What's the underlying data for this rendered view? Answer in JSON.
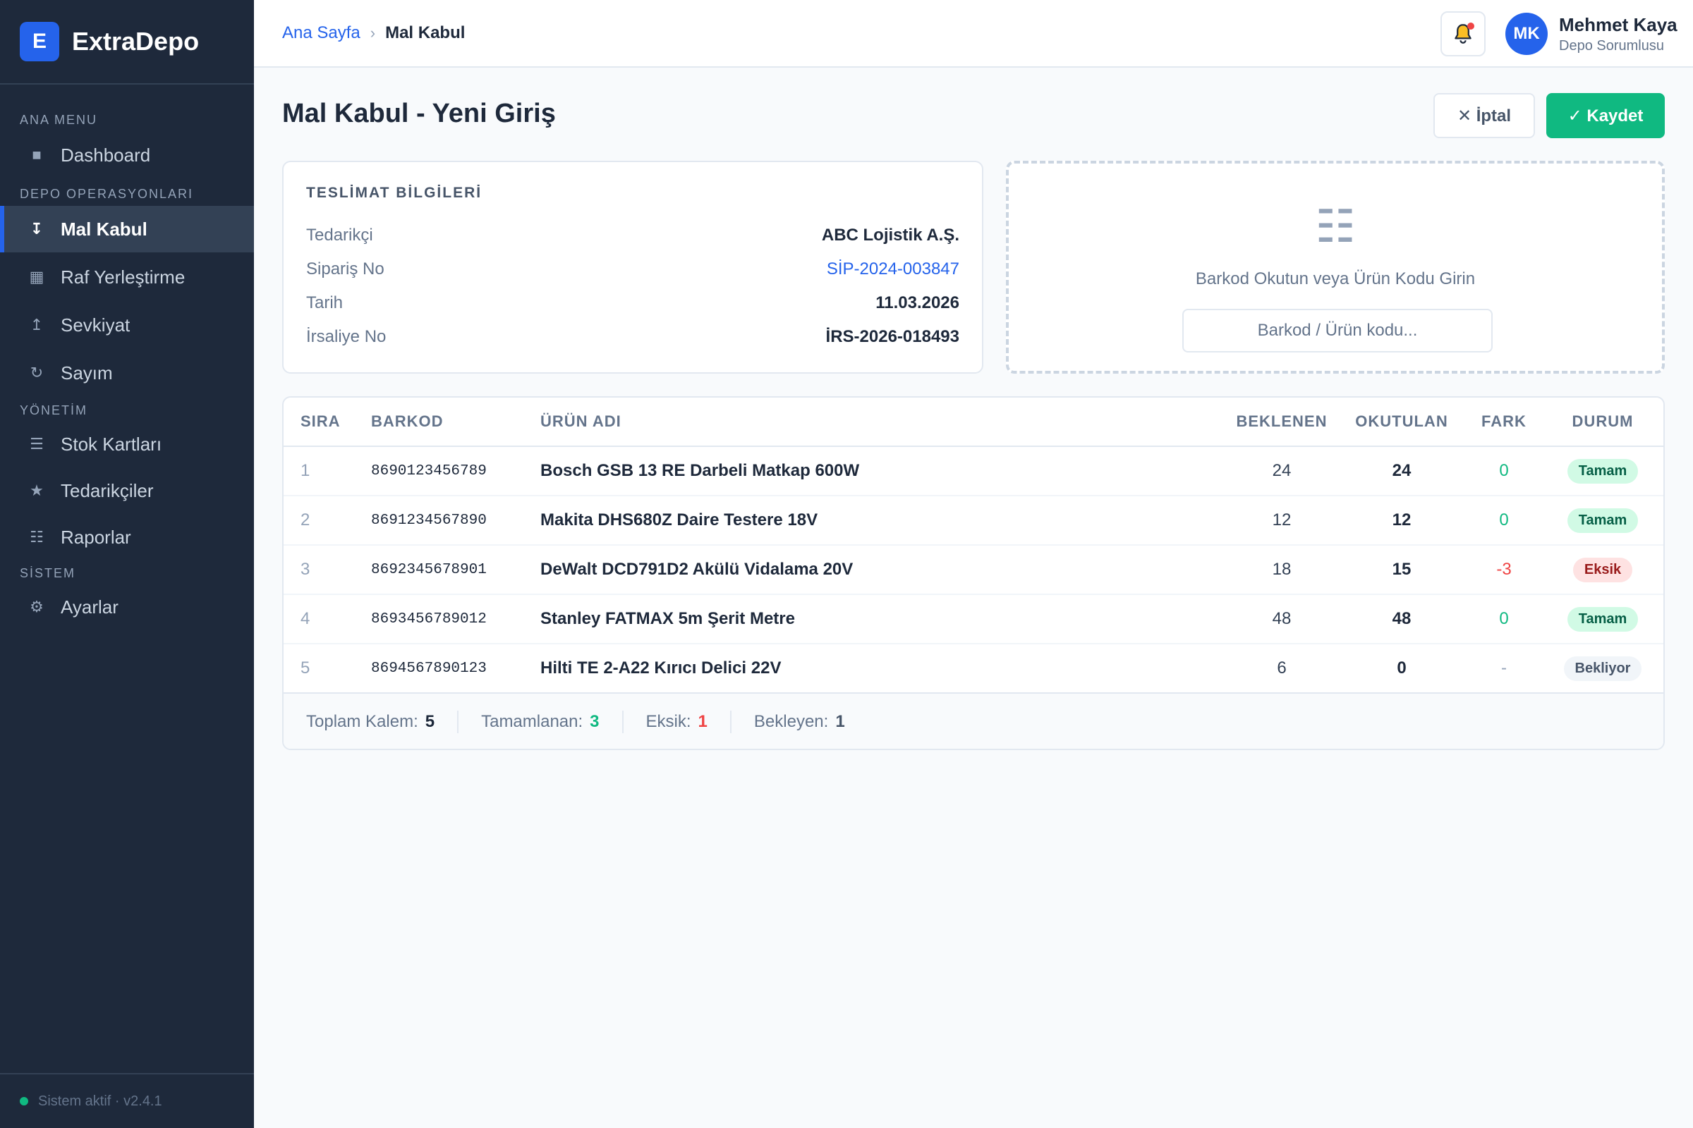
{
  "app": {
    "logo_letter": "E",
    "name": "ExtraDepo"
  },
  "sidebar": {
    "sections": [
      {
        "label": "ANA MENU"
      },
      {
        "label": "DEPO OPERASYONLARI"
      },
      {
        "label": "YÖNETİM"
      },
      {
        "label": "SİSTEM"
      }
    ],
    "items": [
      {
        "label": "Dashboard",
        "icon": "dashboard-icon",
        "glyph": "■"
      },
      {
        "label": "Mal Kabul",
        "icon": "receive-icon",
        "glyph": "↧",
        "active": true
      },
      {
        "label": "Raf Yerleştirme",
        "icon": "shelf-grid-icon",
        "glyph": "▦"
      },
      {
        "label": "Sevkiyat",
        "icon": "ship-icon",
        "glyph": "↥"
      },
      {
        "label": "Sayım",
        "icon": "count-icon",
        "glyph": "↻"
      },
      {
        "label": "Stok Kartları",
        "icon": "stock-list-icon",
        "glyph": "☰"
      },
      {
        "label": "Tedarikçiler",
        "icon": "star-icon",
        "glyph": "★"
      },
      {
        "label": "Raporlar",
        "icon": "report-icon",
        "glyph": "☷"
      },
      {
        "label": "Ayarlar",
        "icon": "gear-icon",
        "glyph": "⚙"
      }
    ],
    "footer": "Sistem aktif · v2.4.1"
  },
  "header": {
    "breadcrumb_home": "Ana Sayfa",
    "breadcrumb_sep": "›",
    "breadcrumb_current": "Mal Kabul",
    "user_initials": "MK",
    "user_name": "Mehmet Kaya",
    "user_role": "Depo Sorumlusu"
  },
  "page": {
    "title": "Mal Kabul - Yeni Giriş",
    "cancel_label": "✕ İptal",
    "save_label": "✓ Kaydet"
  },
  "delivery": {
    "title": "TESLİMAT BİLGİLERİ",
    "fields": [
      {
        "key": "Tedarikçi",
        "value": "ABC Lojistik A.Ş."
      },
      {
        "key": "Sipariş No",
        "value": "SİP-2024-003847"
      },
      {
        "key": "Tarih",
        "value": "11.03.2026"
      },
      {
        "key": "İrsaliye No",
        "value": "İRS-2026-018493"
      }
    ]
  },
  "scanner": {
    "icon_glyph": "☷",
    "prompt": "Barkod Okutun veya Ürün Kodu Girin",
    "placeholder": "Barkod / Ürün kodu..."
  },
  "table": {
    "headers": [
      "SIRA",
      "BARKOD",
      "ÜRÜN ADI",
      "BEKLENEN",
      "OKUTULAN",
      "FARK",
      "DURUM"
    ],
    "rows": [
      {
        "sira": "1",
        "barkod": "8690123456789",
        "urun": "Bosch GSB 13 RE Darbeli Matkap 600W",
        "beklenen": "24",
        "okutulan": "24",
        "fark": "0",
        "durum": "Tamam"
      },
      {
        "sira": "2",
        "barkod": "8691234567890",
        "urun": "Makita DHS680Z Daire Testere 18V",
        "beklenen": "12",
        "okutulan": "12",
        "fark": "0",
        "durum": "Tamam"
      },
      {
        "sira": "3",
        "barkod": "8692345678901",
        "urun": "DeWalt DCD791D2 Akülü Vidalama 20V",
        "beklenen": "18",
        "okutulan": "15",
        "fark": "-3",
        "durum": "Eksik"
      },
      {
        "sira": "4",
        "barkod": "8693456789012",
        "urun": "Stanley FATMAX 5m Şerit Metre",
        "beklenen": "48",
        "okutulan": "48",
        "fark": "0",
        "durum": "Tamam"
      },
      {
        "sira": "5",
        "barkod": "8694567890123",
        "urun": "Hilti TE 2-A22 Kırıcı Delici 22V",
        "beklenen": "6",
        "okutulan": "0",
        "fark": "-",
        "durum": "Bekliyor"
      }
    ],
    "summary": [
      {
        "label": "Toplam Kalem:",
        "value": "5",
        "color": "#1e293b"
      },
      {
        "label": "Tamamlanan:",
        "value": "3",
        "color": "#10b981"
      },
      {
        "label": "Eksik:",
        "value": "1",
        "color": "#ef4444"
      },
      {
        "label": "Bekleyen:",
        "value": "1",
        "color": "#475569"
      }
    ]
  },
  "colors": {
    "accent": "#2563eb",
    "success": "#10b981",
    "danger": "#ef4444",
    "sidebar_bg": "#1e293b"
  }
}
